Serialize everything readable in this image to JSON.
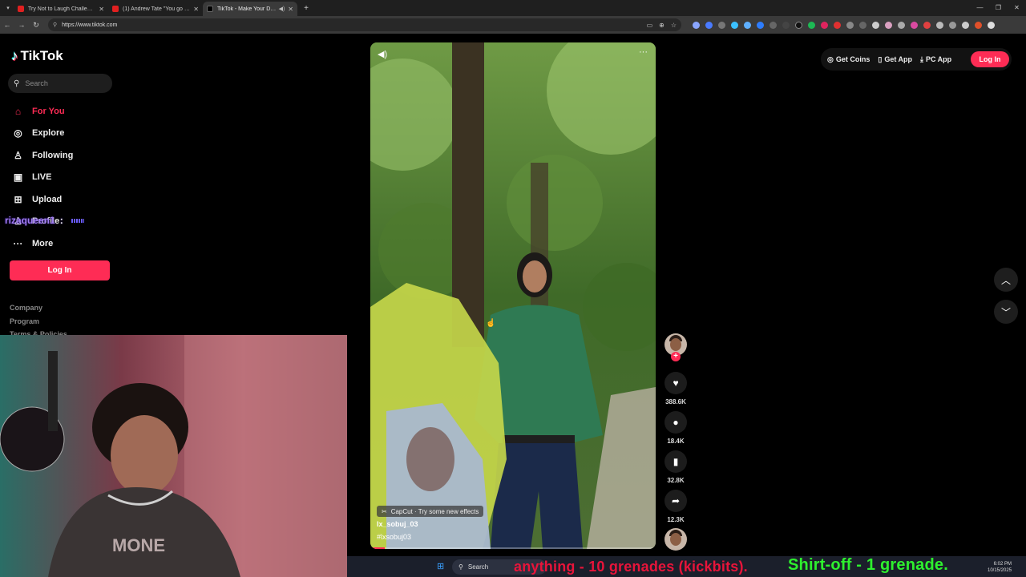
{
  "browser": {
    "tabs": [
      {
        "title": "Try Not to Laugh Challenge 147",
        "icon": "youtube-icon",
        "active": false
      },
      {
        "title": "(1) Andrew Tate \"You go to you",
        "icon": "youtube-icon",
        "active": false
      },
      {
        "title": "TikTok - Make Your Day",
        "icon": "tiktok-icon",
        "active": true
      }
    ],
    "url": "https://www.tiktok.com",
    "window_controls": [
      "—",
      "❐",
      "✕"
    ]
  },
  "tiktok": {
    "logo_text": "TikTok",
    "search_placeholder": "Search",
    "nav": [
      {
        "label": "For You",
        "icon": "home-icon",
        "glyph": "⌂",
        "active": true
      },
      {
        "label": "Explore",
        "icon": "compass-icon",
        "glyph": "◎",
        "active": false
      },
      {
        "label": "Following",
        "icon": "user-icon",
        "glyph": "♙",
        "active": false
      },
      {
        "label": "LIVE",
        "icon": "live-icon",
        "glyph": "▣",
        "active": false
      },
      {
        "label": "Upload",
        "icon": "upload-icon",
        "glyph": "⊞",
        "active": false
      },
      {
        "label": "Profile",
        "icon": "profile-icon",
        "glyph": "♙",
        "active": false
      },
      {
        "label": "More",
        "icon": "more-icon",
        "glyph": "···",
        "active": false
      }
    ],
    "login_label": "Log In",
    "footer_links": [
      "Company",
      "Program",
      "Terms & Policies"
    ],
    "topbar": {
      "get_coins": "Get Coins",
      "get_app": "Get App",
      "pc_app": "PC App",
      "login": "Log In"
    },
    "video": {
      "caption_tag": "CapCut · Try some new effects",
      "author": "lx_sobuj_03",
      "hashtag": "#lxsobuj03",
      "progress": 0.05
    },
    "actions": {
      "likes": "388.6K",
      "comments": "18.4K",
      "saves": "32.8K",
      "shares": "12.3K"
    }
  },
  "stream": {
    "chat_username": "rizaqueen1",
    "chat_dots": ":",
    "ticker_red": "anything - 10 grenades (kickbits).",
    "ticker_green": "Shirt-off -   1 grenade.",
    "webcam_shirt_text": "MONE"
  },
  "taskbar": {
    "search_label": "Search",
    "time": "6:02 PM",
    "date": "10/15/2025"
  },
  "colors": {
    "tiktok_red": "#fe2c55",
    "ticker_red": "#e8143a",
    "ticker_green": "#2ef02e"
  }
}
